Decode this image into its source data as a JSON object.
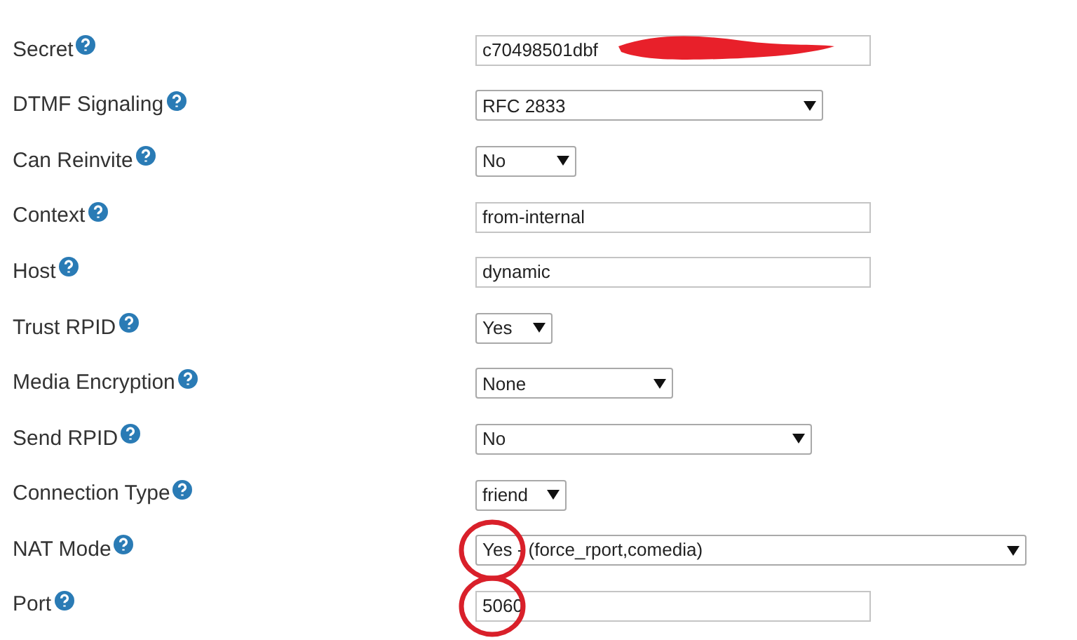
{
  "fields": [
    {
      "label": "Secret",
      "kind": "text",
      "value": "c70498501dbf",
      "redacted": true,
      "circled": false
    },
    {
      "label": "DTMF Signaling",
      "kind": "select",
      "value": "RFC 2833",
      "circled": false
    },
    {
      "label": "Can Reinvite",
      "kind": "select",
      "value": "No",
      "circled": false
    },
    {
      "label": "Context",
      "kind": "text",
      "value": "from-internal",
      "redacted": false,
      "circled": false
    },
    {
      "label": "Host",
      "kind": "text",
      "value": "dynamic",
      "redacted": false,
      "circled": false
    },
    {
      "label": "Trust RPID",
      "kind": "select",
      "value": "Yes",
      "circled": false
    },
    {
      "label": "Media Encryption",
      "kind": "select",
      "value": "None",
      "circled": false
    },
    {
      "label": "Send RPID",
      "kind": "select",
      "value": "No",
      "circled": false
    },
    {
      "label": "Connection Type",
      "kind": "select",
      "value": "friend",
      "circled": false
    },
    {
      "label": "NAT Mode",
      "kind": "select",
      "value": "Yes - (force_rport,comedia)",
      "circled": true
    },
    {
      "label": "Port",
      "kind": "text",
      "value": "5060",
      "redacted": false,
      "circled": true
    }
  ]
}
